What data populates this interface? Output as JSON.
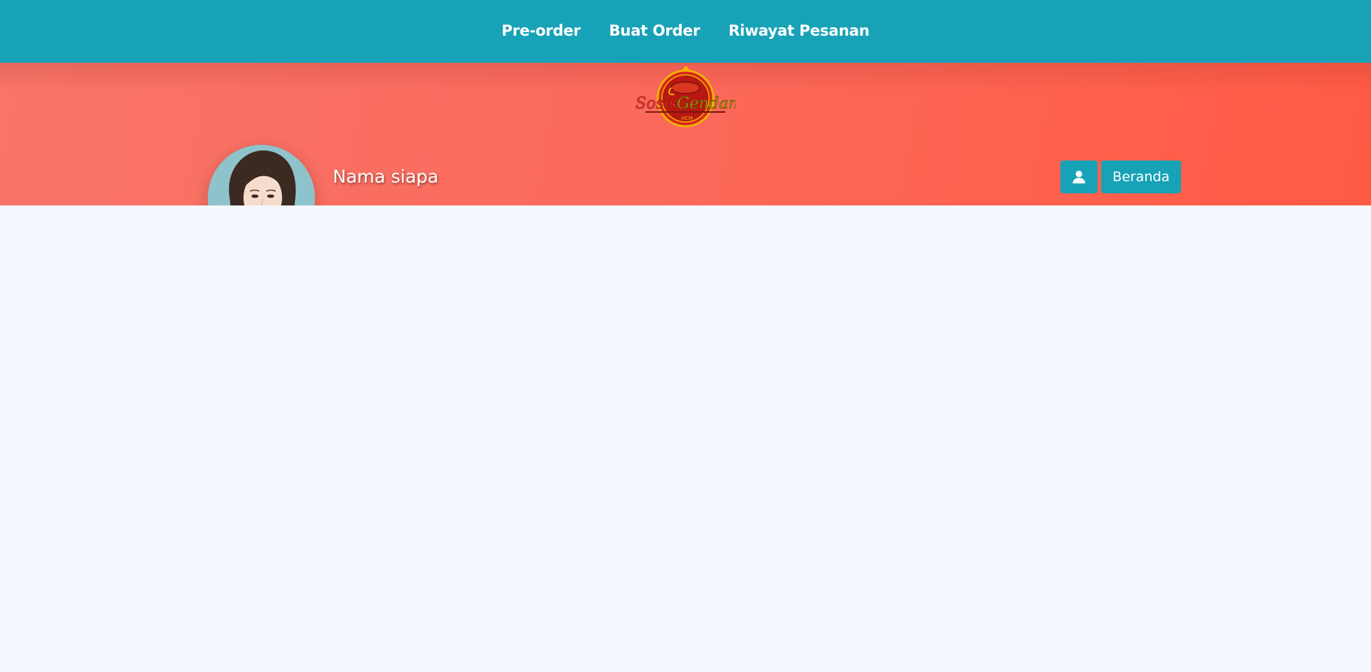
{
  "nav": {
    "items": [
      {
        "label": "Pre-order"
      },
      {
        "label": "Buat Order"
      },
      {
        "label": "Riwayat Pesanan"
      }
    ]
  },
  "brand": {
    "logo_text": "SosisGendang",
    "logo_subtext": "HCM"
  },
  "profile": {
    "name": "Nama siapa"
  },
  "actions": {
    "user_icon": "user-icon",
    "home_label": "Beranda"
  },
  "colors": {
    "primary": "#17a2b8",
    "banner_start": "#f87568",
    "banner_end": "#ff5a44",
    "background": "#f5f8ff"
  }
}
